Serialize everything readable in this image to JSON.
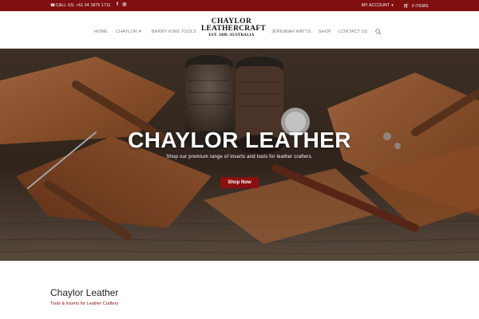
{
  "topbar": {
    "phone": "CALL US: +61 04 1875 1711",
    "social_icons": [
      "facebook-icon",
      "instagram-icon"
    ],
    "facebook_glyph": "f",
    "instagram_glyph": "◎",
    "account": "MY ACCOUNT",
    "cart": "0 ITEMS"
  },
  "header": {
    "logo_line1": "CHAYLOR",
    "logo_line2": "LEATHERCRAFT",
    "logo_line3": "EST. 1989. AUSTRALIA",
    "nav_left": [
      "HOME",
      "CHAYLOR",
      "BARRY KING TOOLS"
    ],
    "nav_right": [
      "JEREMIAH WATTS",
      "SHOP",
      "CONTACT US"
    ]
  },
  "hero": {
    "title": "CHAYLOR LEATHER",
    "subtitle": "Shop our premium range of inserts and tools for leather crafters.",
    "button": "Shop Now"
  },
  "intro": {
    "title": "Chaylor Leather",
    "subtitle": "Tools & Inserts for Leather Crafters"
  },
  "colors": {
    "brand": "#7f0f10",
    "button": "#8b1010"
  }
}
